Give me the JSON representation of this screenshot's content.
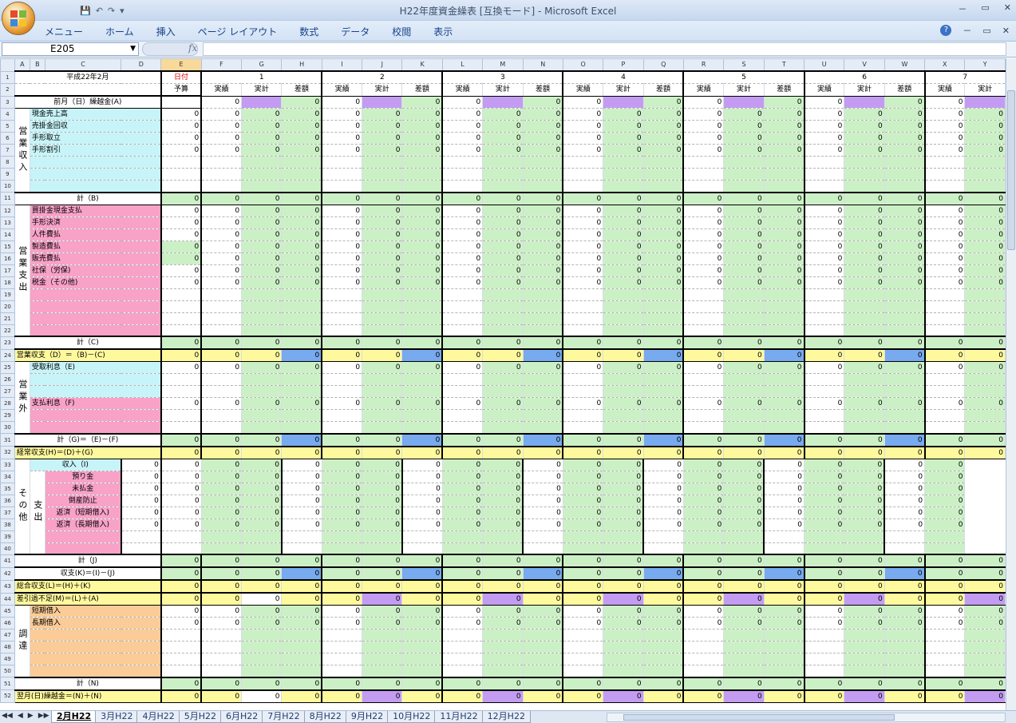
{
  "window": {
    "title": "H22年度資金繰表 [互換モード] - Microsoft Excel",
    "min": "－",
    "restore": "▭",
    "close": "✕"
  },
  "qat": {
    "save": "💾",
    "undo": "↶",
    "redo": "↷",
    "more": "▾"
  },
  "ribbon": {
    "tabs": [
      "メニュー",
      "ホーム",
      "挿入",
      "ページ レイアウト",
      "数式",
      "データ",
      "校閲",
      "表示"
    ],
    "help": "?"
  },
  "formula_bar": {
    "name_box": "E205",
    "fx": "fx",
    "value": ""
  },
  "columns": [
    "A",
    "B",
    "C",
    "D",
    "E",
    "F",
    "G",
    "H",
    "I",
    "J",
    "K",
    "L",
    "M",
    "N",
    "O",
    "P",
    "Q",
    "R",
    "S",
    "T",
    "U",
    "V",
    "W",
    "X",
    "Y"
  ],
  "sheet": {
    "period": "平成22年2月",
    "date_label": "日付",
    "budget_label": "予算",
    "days": [
      "1",
      "2",
      "3",
      "4",
      "5",
      "6",
      "7"
    ],
    "sub_headers": [
      "実績",
      "実計",
      "差額"
    ],
    "zero": "0",
    "labels": {
      "prev_balance": "前月（日）繰越金(A)",
      "op_income_group": "営業収入",
      "op_income_items": [
        "現金売上高",
        "売掛金回収",
        "手形取立",
        "手形割引"
      ],
      "sum_b": "計（B)",
      "op_expense_group": "営業支出",
      "op_expense_items": [
        "買掛金現金支払",
        "手形決済",
        "人件費払",
        "製造費払",
        "販売費払",
        "社保（労保)",
        "税金（その他)"
      ],
      "sum_c": "計（C)",
      "op_balance": "営業収支（D）＝（B)－(C)",
      "non_op_group": "営業外",
      "interest_in": "受取利息（E)",
      "interest_out": "支払利息（F)",
      "sum_g": "計（G)＝（E)－(F)",
      "ordinary_balance": "経常収支(H)＝(D)＋(G)",
      "other_group": "その他",
      "income_i": "収入（I)",
      "out_group": "支出",
      "other_out_items": [
        "預り金",
        "未払金",
        "倒産防止",
        "返済（短期借入)",
        "返済（長期借入)"
      ],
      "sum_j": "計（J)",
      "balance_k": "収支(K)＝(I)－(J)",
      "total_balance": "総合収支(L)＝(H)＋(K)",
      "surplus": "差引過不足(M)＝(L)＋(A)",
      "finance_group": "調達",
      "finance_items": [
        "短期借入",
        "長期借入"
      ],
      "sum_n": "計（N)",
      "next_balance": "翌月(日)繰越金＝(N)＋(N)"
    }
  },
  "sheet_nav": [
    "◀◀",
    "◀",
    "▶",
    "▶▶"
  ],
  "tabs": [
    "2月H22",
    "3月H22",
    "4月H22",
    "5月H22",
    "6月H22",
    "7月H22",
    "8月H22",
    "9月H22",
    "10月H22",
    "11月H22",
    "12月H22"
  ],
  "colors": {
    "green": "#ccf0c6",
    "yellow": "#fff99d",
    "blue": "#77aaee",
    "purple": "#c39cf2",
    "pink": "#f8a2c8",
    "cyan": "#c7f4f8",
    "orange": "#fbcc98"
  }
}
